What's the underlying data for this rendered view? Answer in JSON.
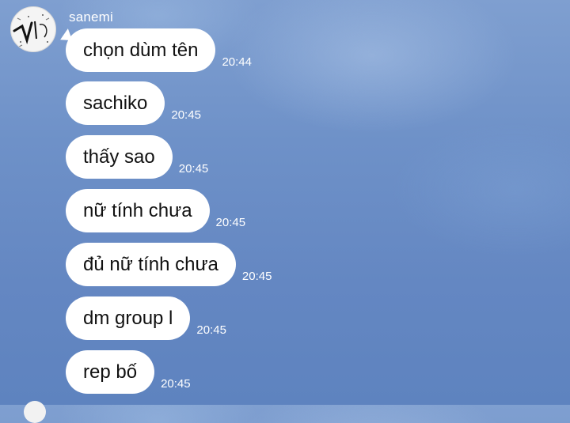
{
  "chat": {
    "sender": "sanemi",
    "messages": [
      {
        "text": "chọn dùm tên",
        "time": "20:44"
      },
      {
        "text": "sachiko",
        "time": "20:45"
      },
      {
        "text": "thấy sao",
        "time": "20:45"
      },
      {
        "text": "nữ tính chưa",
        "time": "20:45"
      },
      {
        "text": "đủ nữ tính chưa",
        "time": "20:45"
      },
      {
        "text": "dm group l",
        "time": "20:45"
      },
      {
        "text": "rep bố",
        "time": "20:45"
      }
    ]
  },
  "colors": {
    "bubble": "#ffffff",
    "background": "#6e91c8",
    "timestamp": "#ffffff"
  }
}
